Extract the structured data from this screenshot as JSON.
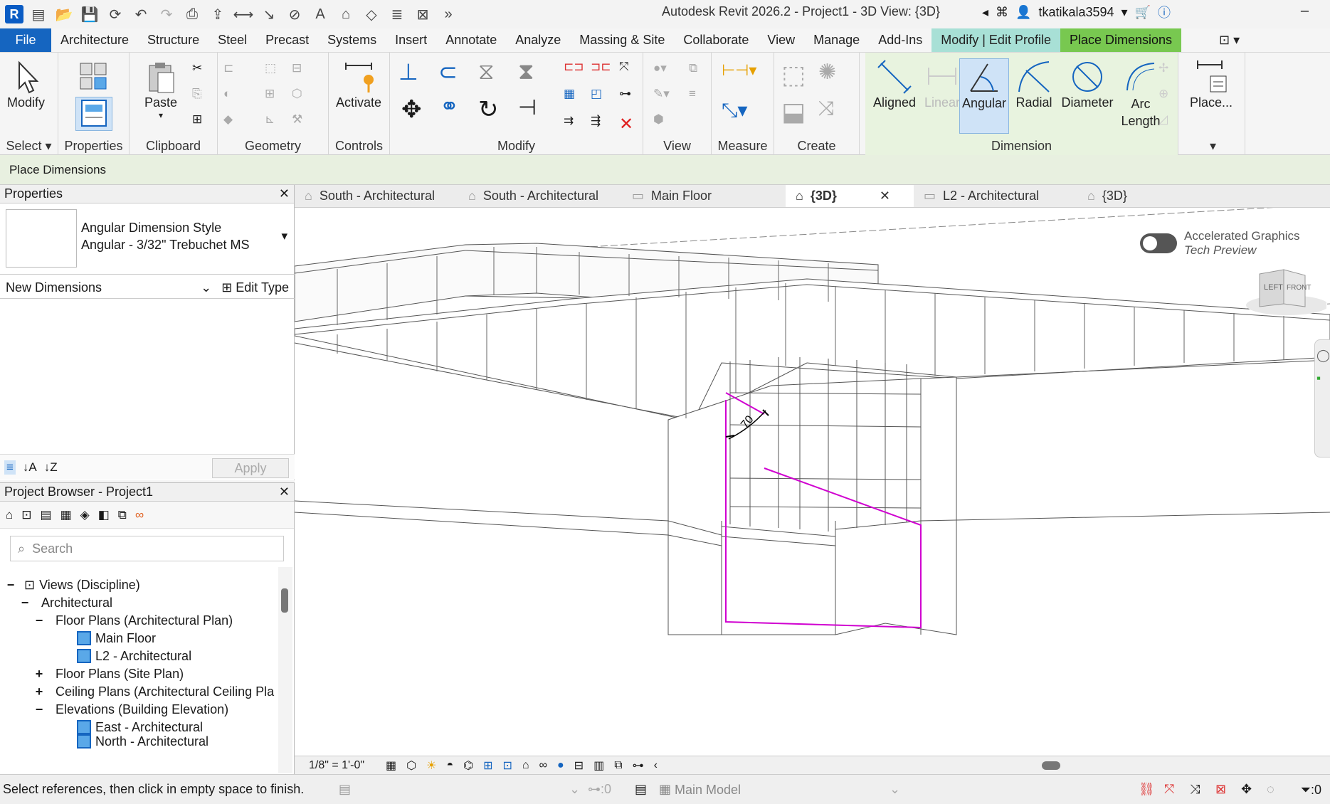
{
  "app": {
    "title": "Autodesk Revit 2026.2 - Project1 - 3D View: {3D}",
    "user": "tkatikala3594"
  },
  "menu": {
    "file": "File",
    "tabs": [
      "Architecture",
      "Structure",
      "Steel",
      "Precast",
      "Systems",
      "Insert",
      "Annotate",
      "Analyze",
      "Massing & Site",
      "Collaborate",
      "View",
      "Manage",
      "Add-Ins"
    ],
    "context1": "Modify | Edit Profile",
    "context2": "Place Dimensions"
  },
  "ribbon": {
    "modify": "Modify",
    "properties": "Properties",
    "paste": "Paste",
    "activate": "Activate",
    "panels": {
      "select": "Select",
      "properties": "Properties",
      "clipboard": "Clipboard",
      "geometry": "Geometry",
      "controls": "Controls",
      "modify": "Modify",
      "view": "View",
      "measure": "Measure",
      "create": "Create",
      "dimension": "Dimension"
    },
    "dimension_tools": {
      "aligned": "Aligned",
      "linear": "Linear",
      "angular": "Angular",
      "radial": "Radial",
      "diameter": "Diameter",
      "arc1": "Arc",
      "arc2": "Length",
      "place": "Place..."
    }
  },
  "options_bar": {
    "label": "Place Dimensions"
  },
  "properties": {
    "header": "Properties",
    "type_line1": "Angular Dimension Style",
    "type_line2": "Angular - 3/32\" Trebuchet MS",
    "instance": "New Dimensions",
    "edit_type": "Edit Type",
    "apply": "Apply"
  },
  "browser": {
    "header": "Project Browser - Project1",
    "search_placeholder": "Search",
    "tree": [
      "Views (Discipline)",
      "Architectural",
      "Floor Plans (Architectural Plan)",
      "Main Floor",
      "L2 - Architectural",
      "Floor Plans (Site Plan)",
      "Ceiling Plans (Architectural Ceiling Pla",
      "Elevations (Building Elevation)",
      "East - Architectural",
      "North - Architectural"
    ]
  },
  "view_tabs": [
    {
      "label": "South - Architectural"
    },
    {
      "label": "South - Architectural"
    },
    {
      "label": "Main Floor"
    },
    {
      "label": "{3D}",
      "active": true
    },
    {
      "label": "L2 - Architectural"
    },
    {
      "label": "{3D}"
    }
  ],
  "canvas": {
    "accel_line1": "Accelerated Graphics",
    "accel_line2": "Tech Preview",
    "cube_left": "LEFT",
    "cube_front": "FRONT",
    "dimension_value": "70"
  },
  "view_control": {
    "scale": "1/8\" = 1'-0\""
  },
  "status": {
    "message": "Select references, then click in empty space to finish.",
    "workset_count": ":0",
    "model": "Main Model",
    "filter_count": ":0"
  },
  "colors": {
    "file_tab": "#1565c0",
    "ctx_modify": "#a8e0d6",
    "ctx_place": "#78c850",
    "sketch": "#d000d0"
  }
}
